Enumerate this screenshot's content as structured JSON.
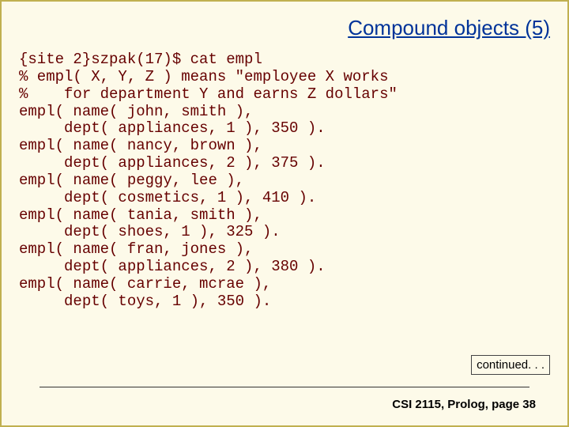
{
  "title": "Compound objects (5)",
  "code": "{site 2}szpak(17)$ cat empl\n% empl( X, Y, Z ) means \"employee X works\n%    for department Y and earns Z dollars\"\nempl( name( john, smith ),\n     dept( appliances, 1 ), 350 ).\nempl( name( nancy, brown ),\n     dept( appliances, 2 ), 375 ).\nempl( name( peggy, lee ),\n     dept( cosmetics, 1 ), 410 ).\nempl( name( tania, smith ),\n     dept( shoes, 1 ), 325 ).\nempl( name( fran, jones ),\n     dept( appliances, 2 ), 380 ).\nempl( name( carrie, mcrae ),\n     dept( toys, 1 ), 350 ).",
  "continued": "continued. . .",
  "footer": "CSI 2115, Prolog, page 38"
}
